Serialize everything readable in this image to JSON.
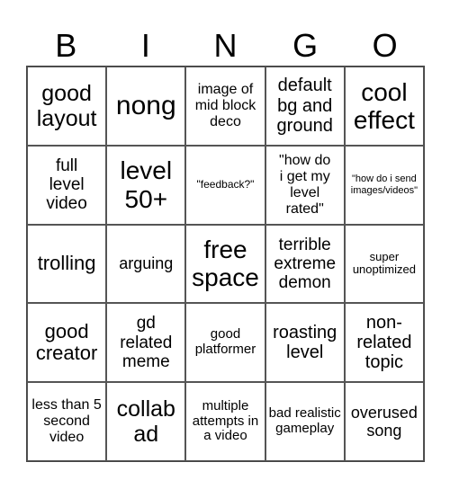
{
  "header": [
    "B",
    "I",
    "N",
    "G",
    "O"
  ],
  "cells": [
    "good layout",
    "nong",
    "image of mid block deco",
    "default bg and ground",
    "cool effect",
    "full level video",
    "level 50+",
    "\"feedback?\"",
    "\"how do i get my level rated\"",
    "\"how do i send images/videos\"",
    "trolling",
    "arguing",
    "free space",
    "terrible extreme demon",
    "super unoptimized",
    "good creator",
    "gd related meme",
    "good platformer",
    "roasting level",
    "non-related topic",
    "less than 5 second video",
    "collab ad",
    "multiple attempts in a video",
    "bad realistic gameplay",
    "overused song"
  ]
}
